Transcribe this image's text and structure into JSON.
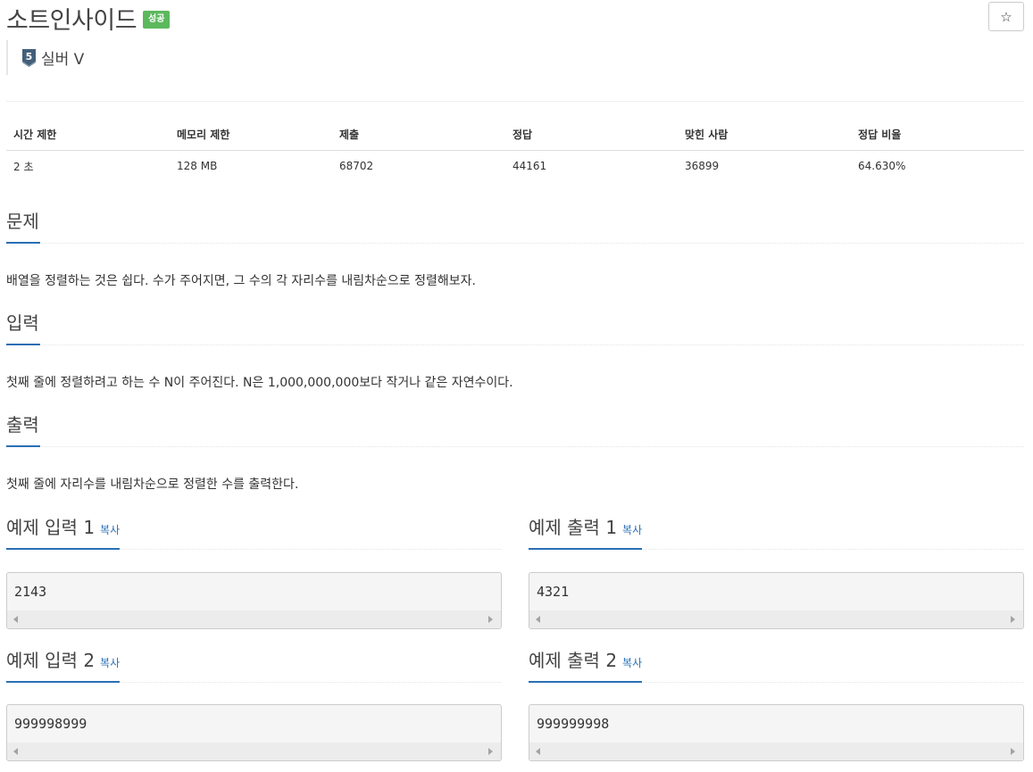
{
  "problem": {
    "title": "소트인사이드",
    "result_badge": "성공",
    "star_label": "☆",
    "tier": {
      "icon": "silver-tier-icon",
      "level_number": "5",
      "label": "실버 V"
    }
  },
  "stats": {
    "headers": [
      "시간 제한",
      "메모리 제한",
      "제출",
      "정답",
      "맞힌 사람",
      "정답 비율"
    ],
    "values": [
      "2 초",
      "128 MB",
      "68702",
      "44161",
      "36899",
      "64.630%"
    ]
  },
  "sections": {
    "description": {
      "heading": "문제",
      "text": "배열을 정렬하는 것은 쉽다. 수가 주어지면, 그 수의 각 자리수를 내림차순으로 정렬해보자."
    },
    "input": {
      "heading": "입력",
      "text": "첫째 줄에 정렬하려고 하는 수 N이 주어진다. N은 1,000,000,000보다 작거나 같은 자연수이다."
    },
    "output": {
      "heading": "출력",
      "text": "첫째 줄에 자리수를 내림차순으로 정렬한 수를 출력한다."
    }
  },
  "samples": [
    {
      "input_heading": "예제 입력 1",
      "output_heading": "예제 출력 1",
      "copy_label": "복사",
      "input": "2143",
      "output": "4321"
    },
    {
      "input_heading": "예제 입력 2",
      "output_heading": "예제 출력 2",
      "copy_label": "복사",
      "input": "999998999",
      "output": "999999998"
    }
  ],
  "colors": {
    "accent": "#2a6fb5",
    "success": "#5cb85c",
    "tier_silver": "#435f7a"
  }
}
